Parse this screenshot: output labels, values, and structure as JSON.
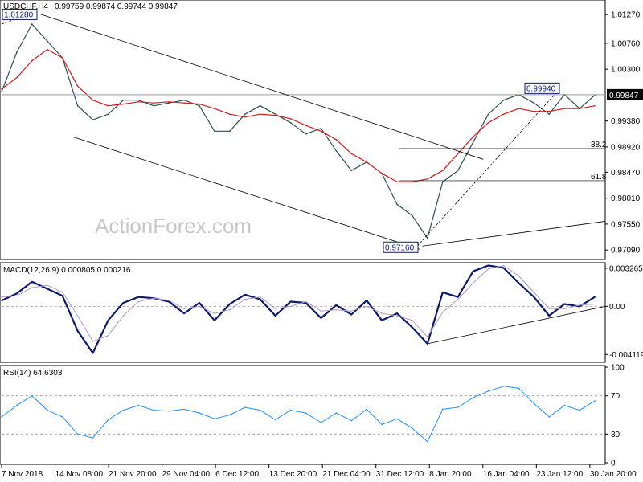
{
  "chart_data": [
    {
      "panel": "price",
      "type": "line",
      "title": "USDCHF,H4",
      "ohlc_label": "0.99759 0.99874 0.99744 0.99847",
      "symbol": "USDCHF",
      "timeframe": "H4",
      "last_price": 0.99847,
      "ylim": [
        0.9695,
        1.015
      ],
      "y_tick_labels": [
        "1.01270",
        "1.00760",
        "1.00300",
        "0.99380",
        "0.98920",
        "0.98470",
        "0.98010",
        "0.97550",
        "0.97090"
      ],
      "x_tick_labels": [
        "7 Nov 2018",
        "14 Nov 08:00",
        "21 Nov 20:00",
        "29 Nov 04:00",
        "6 Dec 12:00",
        "13 Dec 20:00",
        "21 Dec 04:00",
        "31 Dec 12:00",
        "8 Jan 20:00",
        "16 Jan 04:00",
        "23 Jan 12:00",
        "30 Jan 20:00"
      ],
      "annotations": {
        "high_label": "1.01280",
        "low_label": "0.97160",
        "recent_high_label": "0.99940",
        "fib_382": "38.2",
        "fib_618": "61.8"
      },
      "levels": {
        "high": 1.0128,
        "low": 0.9716,
        "recent_high": 0.9994,
        "fib_382": 0.9889,
        "fib_618": 0.9832
      },
      "series": [
        {
          "name": "price",
          "color": "#2f4f4f",
          "x": [
            0,
            6,
            12,
            18,
            24,
            30,
            36,
            42,
            48,
            54,
            60,
            66,
            72,
            78,
            84,
            90,
            96,
            102,
            108,
            114,
            120,
            126,
            132,
            138,
            144,
            150,
            156,
            162,
            168,
            174,
            180,
            186,
            192,
            198,
            204,
            210,
            216,
            222,
            228,
            234
          ],
          "values": [
            0.999,
            1.006,
            1.011,
            1.008,
            1.005,
            0.9965,
            0.994,
            0.995,
            0.9975,
            0.9975,
            0.9965,
            0.997,
            0.9975,
            0.9965,
            0.992,
            0.992,
            0.995,
            0.9965,
            0.995,
            0.9935,
            0.9915,
            0.9925,
            0.9885,
            0.985,
            0.9865,
            0.9845,
            0.979,
            0.977,
            0.973,
            0.983,
            0.985,
            0.99,
            0.995,
            0.9975,
            0.9985,
            0.997,
            0.995,
            0.9985,
            0.996,
            0.9984
          ]
        },
        {
          "name": "sma",
          "color": "#d81b1b",
          "x": [
            0,
            6,
            12,
            18,
            24,
            30,
            36,
            42,
            48,
            54,
            60,
            66,
            72,
            78,
            84,
            90,
            96,
            102,
            108,
            114,
            120,
            126,
            132,
            138,
            144,
            150,
            156,
            162,
            168,
            174,
            180,
            186,
            192,
            198,
            204,
            210,
            216,
            222,
            228,
            234
          ],
          "values": [
            0.9995,
            1.0015,
            1.0045,
            1.0065,
            1.005,
            1.0,
            0.9975,
            0.9965,
            0.9968,
            0.9972,
            0.997,
            0.9972,
            0.997,
            0.9968,
            0.996,
            0.995,
            0.9945,
            0.995,
            0.9948,
            0.9942,
            0.993,
            0.992,
            0.9905,
            0.988,
            0.9865,
            0.9845,
            0.983,
            0.983,
            0.9835,
            0.985,
            0.988,
            0.991,
            0.9935,
            0.995,
            0.996,
            0.9955,
            0.9955,
            0.996,
            0.996,
            0.9965
          ]
        }
      ]
    },
    {
      "panel": "macd",
      "type": "line",
      "title": "MACD(12,26,9) 0.000805 0.000216",
      "ylim": [
        -0.00465,
        0.0036
      ],
      "y_tick_labels": [
        "0.003265",
        "0.00",
        "-0.004119"
      ],
      "series": [
        {
          "name": "MACD",
          "color": "#0b1a6e",
          "x": [
            0,
            6,
            12,
            18,
            24,
            30,
            36,
            42,
            48,
            54,
            60,
            66,
            72,
            78,
            84,
            90,
            96,
            102,
            108,
            114,
            120,
            126,
            132,
            138,
            144,
            150,
            156,
            162,
            168,
            174,
            180,
            186,
            192,
            198,
            204,
            210,
            216,
            222,
            228,
            234
          ],
          "values": [
            0.0005,
            0.0011,
            0.0021,
            0.0015,
            0.0009,
            -0.0021,
            -0.004,
            -0.0012,
            0.0003,
            0.0008,
            0.0007,
            0.0004,
            -0.0006,
            0.0003,
            -0.0012,
            0.0002,
            0.001,
            0.0006,
            -0.0008,
            0.0004,
            0.0003,
            -0.001,
            0.0001,
            -0.0007,
            0.0005,
            -0.0012,
            -0.0006,
            -0.0018,
            -0.0032,
            0.0012,
            0.0008,
            0.003,
            0.0035,
            0.0033,
            0.002,
            0.0008,
            -0.0008,
            0.0002,
            0.0,
            0.0008
          ]
        },
        {
          "name": "Signal",
          "color": "#b39acb",
          "x": [
            0,
            6,
            12,
            18,
            24,
            30,
            36,
            42,
            48,
            54,
            60,
            66,
            72,
            78,
            84,
            90,
            96,
            102,
            108,
            114,
            120,
            126,
            132,
            138,
            144,
            150,
            156,
            162,
            168,
            174,
            180,
            186,
            192,
            198,
            204,
            210,
            216,
            222,
            228,
            234
          ],
          "values": [
            0.0008,
            0.0009,
            0.0016,
            0.0018,
            0.0012,
            -0.0008,
            -0.003,
            -0.0025,
            -0.0008,
            0.0004,
            0.0007,
            0.0005,
            -0.0002,
            0.0,
            -0.0006,
            -0.0003,
            0.0006,
            0.0008,
            -0.0002,
            0.0,
            0.0004,
            -0.0004,
            -0.0003,
            -0.0004,
            0.0,
            -0.0006,
            -0.0008,
            -0.0012,
            -0.0026,
            -0.0005,
            0.0006,
            0.002,
            0.0032,
            0.0035,
            0.0026,
            0.0012,
            -0.0002,
            -0.0002,
            0.0001,
            0.0002
          ]
        }
      ]
    },
    {
      "panel": "rsi",
      "type": "line",
      "title": "RSI(14) 64.6303",
      "ylim": [
        0,
        100
      ],
      "y_tick_labels": [
        "100",
        "70",
        "30",
        "0"
      ],
      "series": [
        {
          "name": "RSI",
          "color": "#1e90ff",
          "x": [
            0,
            6,
            12,
            18,
            24,
            30,
            36,
            42,
            48,
            54,
            60,
            66,
            72,
            78,
            84,
            90,
            96,
            102,
            108,
            114,
            120,
            126,
            132,
            138,
            144,
            150,
            156,
            162,
            168,
            174,
            180,
            186,
            192,
            198,
            204,
            210,
            216,
            222,
            228,
            234
          ],
          "values": [
            48,
            60,
            70,
            55,
            48,
            30,
            26,
            45,
            55,
            60,
            55,
            54,
            56,
            52,
            46,
            50,
            58,
            55,
            45,
            55,
            52,
            42,
            52,
            44,
            56,
            40,
            46,
            36,
            22,
            56,
            58,
            68,
            75,
            80,
            78,
            62,
            48,
            60,
            55,
            64.6
          ]
        }
      ]
    }
  ],
  "watermark": "ActionForex.com",
  "colors": {
    "axis": "#000000",
    "frame": "#000000",
    "channel_lines": "#000000",
    "fib_lines": "#000000",
    "level_lines": "#9a9a9a",
    "price_label_bg": "#000000",
    "price_label_fg": "#ffffff",
    "box_label_border": "#0b1a6e",
    "box_label_fg": "#0b1a6e",
    "watermark": "#c8c8c8"
  }
}
